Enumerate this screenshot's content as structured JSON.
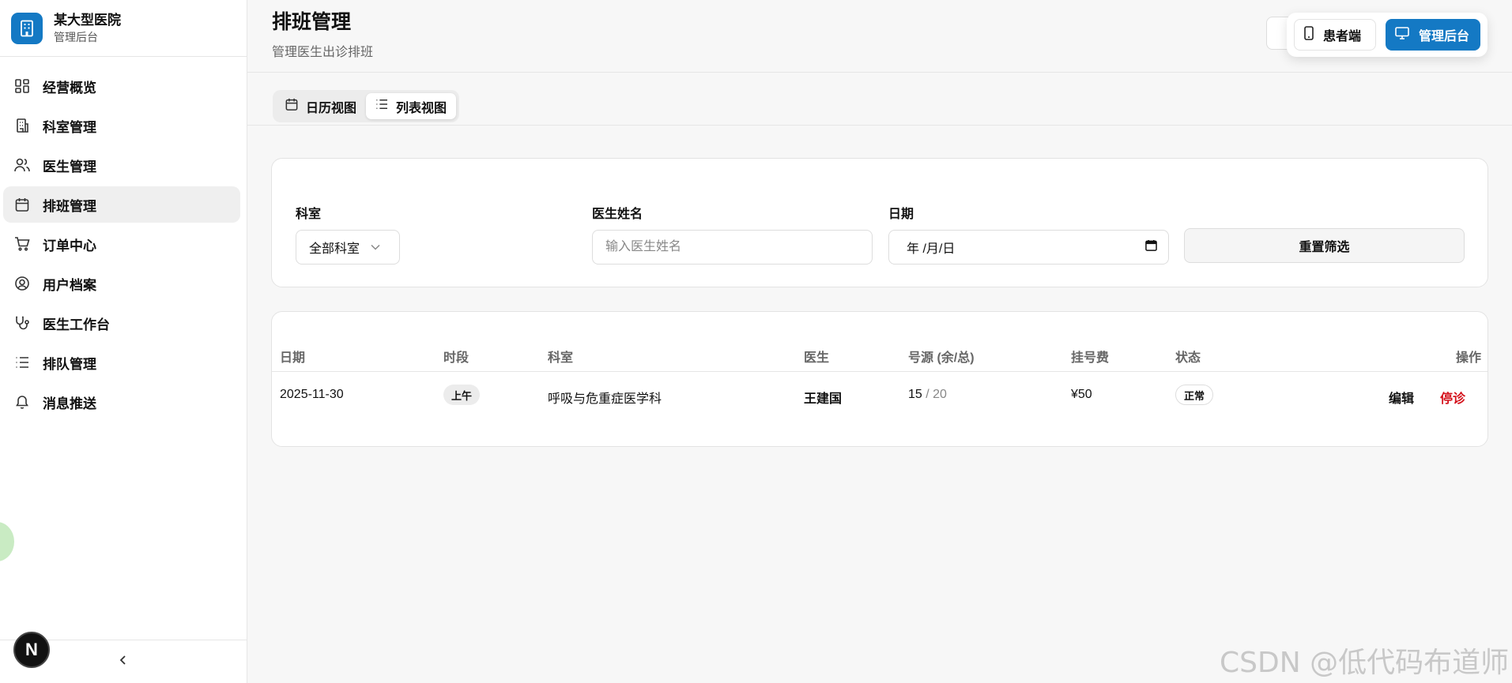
{
  "brand": {
    "name": "某大型医院",
    "subtitle": "管理后台",
    "logo_icon": "hospital-building-icon"
  },
  "sidebar": {
    "items": [
      {
        "label": "经营概览",
        "icon": "dashboard-grid-icon",
        "active": false
      },
      {
        "label": "科室管理",
        "icon": "building-icon",
        "active": false
      },
      {
        "label": "医生管理",
        "icon": "users-icon",
        "active": false
      },
      {
        "label": "排班管理",
        "icon": "calendar-icon",
        "active": true
      },
      {
        "label": "订单中心",
        "icon": "cart-icon",
        "active": false
      },
      {
        "label": "用户档案",
        "icon": "user-circle-icon",
        "active": false
      },
      {
        "label": "医生工作台",
        "icon": "stethoscope-icon",
        "active": false
      },
      {
        "label": "排队管理",
        "icon": "list-icon",
        "active": false
      },
      {
        "label": "消息推送",
        "icon": "bell-icon",
        "active": false
      }
    ],
    "collapse_icon": "chevron-left-icon",
    "badge_letter": "N"
  },
  "header": {
    "title": "排班管理",
    "subtitle": "管理医生出诊排班"
  },
  "mode_switch": {
    "patient_label": "患者端",
    "admin_label": "管理后台"
  },
  "view_tabs": {
    "calendar_label": "日历视图",
    "list_label": "列表视图",
    "active": "list"
  },
  "filters": {
    "department_label": "科室",
    "department_value": "全部科室",
    "doctor_label": "医生姓名",
    "doctor_placeholder": "输入医生姓名",
    "date_label": "日期",
    "date_value": "年 /月/日",
    "reset_label": "重置筛选"
  },
  "table": {
    "headers": {
      "date": "日期",
      "period": "时段",
      "department": "科室",
      "doctor": "医生",
      "slots": "号源 (余/总)",
      "fee": "挂号费",
      "status": "状态",
      "actions": "操作"
    },
    "rows": [
      {
        "date": "2025-11-30",
        "period": "上午",
        "department": "呼吸与危重症医学科",
        "doctor": "王建国",
        "slots_remaining": "15",
        "slots_total": " / 20",
        "fee": "¥50",
        "status": "正常",
        "edit": "编辑",
        "stop": "停诊"
      }
    ]
  },
  "watermark": "CSDN @低代码布道师",
  "colors": {
    "accent": "#1479c4",
    "danger": "#d4111b",
    "active_bg": "#efefef"
  }
}
